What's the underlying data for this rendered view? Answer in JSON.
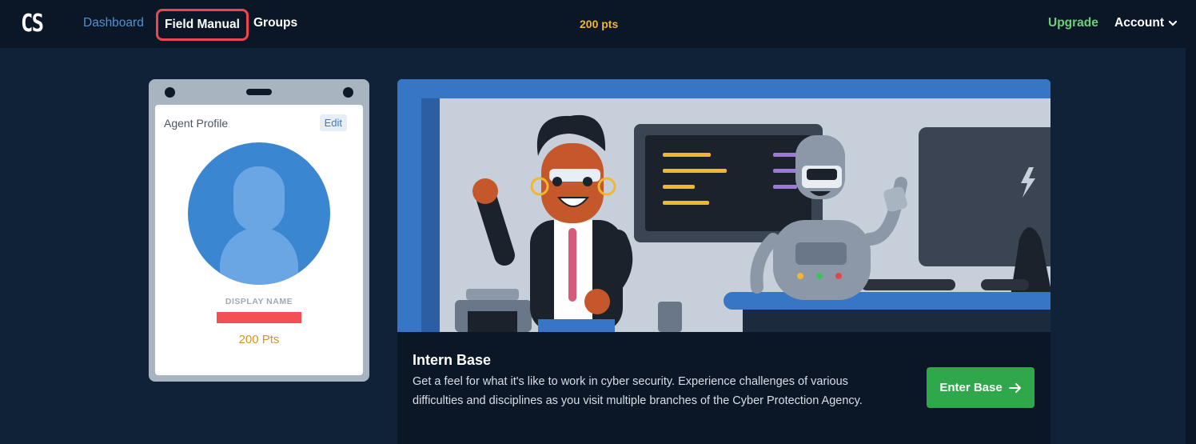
{
  "nav": {
    "logo": "CS",
    "dashboard": "Dashboard",
    "field_manual": "Field Manual",
    "groups": "Groups",
    "points": "200 pts",
    "upgrade": "Upgrade",
    "account": "Account"
  },
  "profile": {
    "title": "Agent Profile",
    "edit": "Edit",
    "display_name_label": "DISPLAY NAME",
    "points": "200 Pts"
  },
  "base": {
    "title": "Intern Base",
    "description": "Get a feel for what it's like to work in cyber security. Experience challenges of various difficulties and disciplines as you visit multiple branches of the Cyber Protection Agency.",
    "enter_label": "Enter Base"
  },
  "colors": {
    "nav_bg": "#0b1727",
    "page_bg": "#0f2238",
    "accent_blue": "#4f91d6",
    "points_gold": "#f2b632",
    "upgrade_green": "#6bd07a",
    "enter_green": "#2ea84a",
    "highlight_red": "#ef4550"
  }
}
